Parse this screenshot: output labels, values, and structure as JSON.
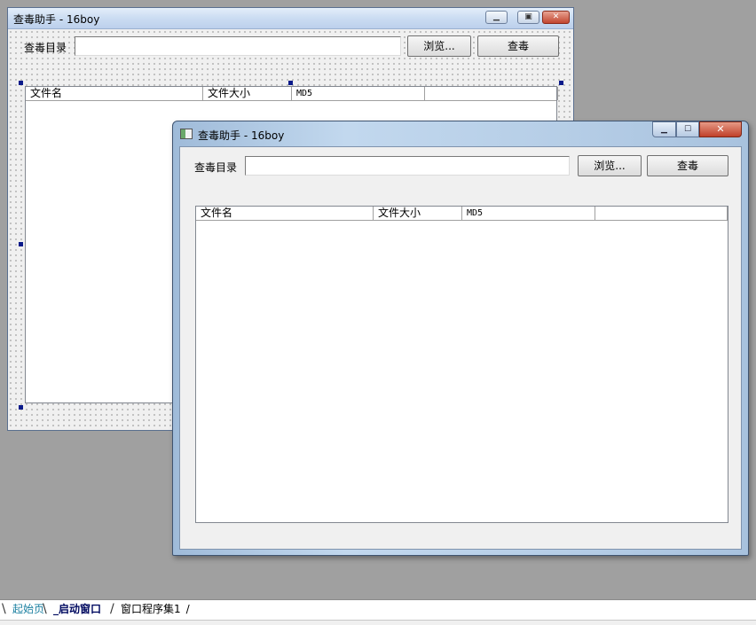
{
  "design_window": {
    "title": "查毒助手 - 16boy",
    "dir_label": "查毒目录",
    "dir_value": "",
    "browse_label": "浏览...",
    "scan_label": "查毒",
    "columns": [
      "文件名",
      "文件大小",
      "MD5",
      ""
    ]
  },
  "run_window": {
    "title": "查毒助手 - 16boy",
    "dir_label": "查毒目录",
    "dir_value": "",
    "browse_label": "浏览...",
    "scan_label": "查毒",
    "columns": [
      "文件名",
      "文件大小",
      "MD5",
      ""
    ]
  },
  "caption_icons": {
    "minimize": "minimize-icon",
    "maximize": "maximize-icon",
    "close": "close-icon"
  },
  "tabs": {
    "start_page": "起始页",
    "startup_window": "_启动窗口",
    "window_module": "窗口程序集1"
  },
  "colors": {
    "desktop": "#a0a0a0",
    "start_tab": "#1a7fa0",
    "handle": "#0a1a8a"
  }
}
